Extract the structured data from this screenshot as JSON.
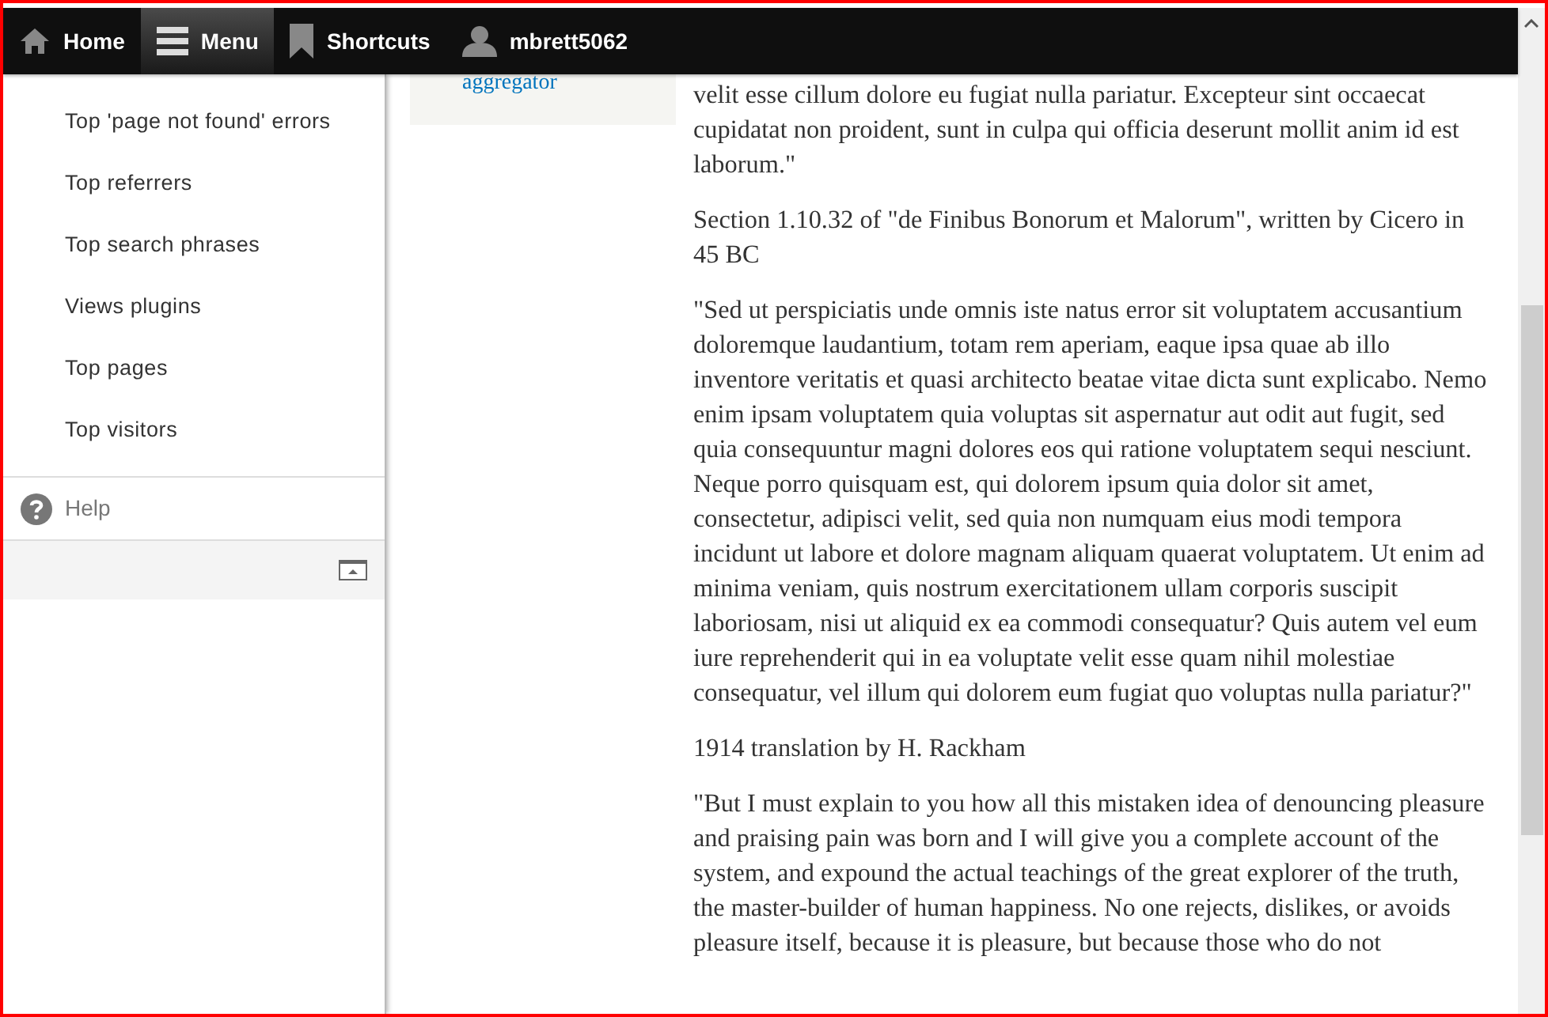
{
  "toolbar": {
    "tabs": [
      {
        "kind": "home",
        "label": "Home",
        "selected": false
      },
      {
        "kind": "menu",
        "label": "Menu",
        "selected": true
      },
      {
        "kind": "shortcuts",
        "label": "Shortcuts",
        "selected": false
      },
      {
        "kind": "user",
        "label": "mbrett5062",
        "selected": false
      }
    ]
  },
  "tray": {
    "items": [
      {
        "label": "Top 'page not found' errors"
      },
      {
        "label": "Top referrers"
      },
      {
        "label": "Top search phrases"
      },
      {
        "label": "Views plugins"
      },
      {
        "label": "Top pages"
      },
      {
        "label": "Top visitors"
      }
    ],
    "help": "Help"
  },
  "sidebar_box": {
    "link": "aggregator"
  },
  "content": {
    "paragraphs": [
      "velit esse cillum dolore eu fugiat nulla pariatur. Excepteur sint occaecat cupidatat non proident, sunt in culpa qui officia deserunt mollit anim id est laborum.\"",
      "Section 1.10.32 of \"de Finibus Bonorum et Malorum\", written by Cicero in 45 BC",
      "\"Sed ut perspiciatis unde omnis iste natus error sit voluptatem accusantium doloremque laudantium, totam rem aperiam, eaque ipsa quae ab illo inventore veritatis et quasi architecto beatae vitae dicta sunt explicabo. Nemo enim ipsam voluptatem quia voluptas sit aspernatur aut odit aut fugit, sed quia consequuntur magni dolores eos qui ratione voluptatem sequi nesciunt. Neque porro quisquam est, qui dolorem ipsum quia dolor sit amet, consectetur, adipisci velit, sed quia non numquam eius modi tempora incidunt ut labore et dolore magnam aliquam quaerat voluptatem. Ut enim ad minima veniam, quis nostrum exercitationem ullam corporis suscipit laboriosam, nisi ut aliquid ex ea commodi consequatur? Quis autem vel eum iure reprehenderit qui in ea voluptate velit esse quam nihil molestiae consequatur, vel illum qui dolorem eum fugiat quo voluptas nulla pariatur?\"",
      "1914 translation by H. Rackham",
      "\"But I must explain to you how all this mistaken idea of denouncing pleasure and praising pain was born and I will give you a complete account of the system, and expound the actual teachings of the great explorer of the truth, the master-builder of human happiness. No one rejects, dislikes, or avoids pleasure itself, because it is pleasure, but because those who do not"
    ]
  }
}
